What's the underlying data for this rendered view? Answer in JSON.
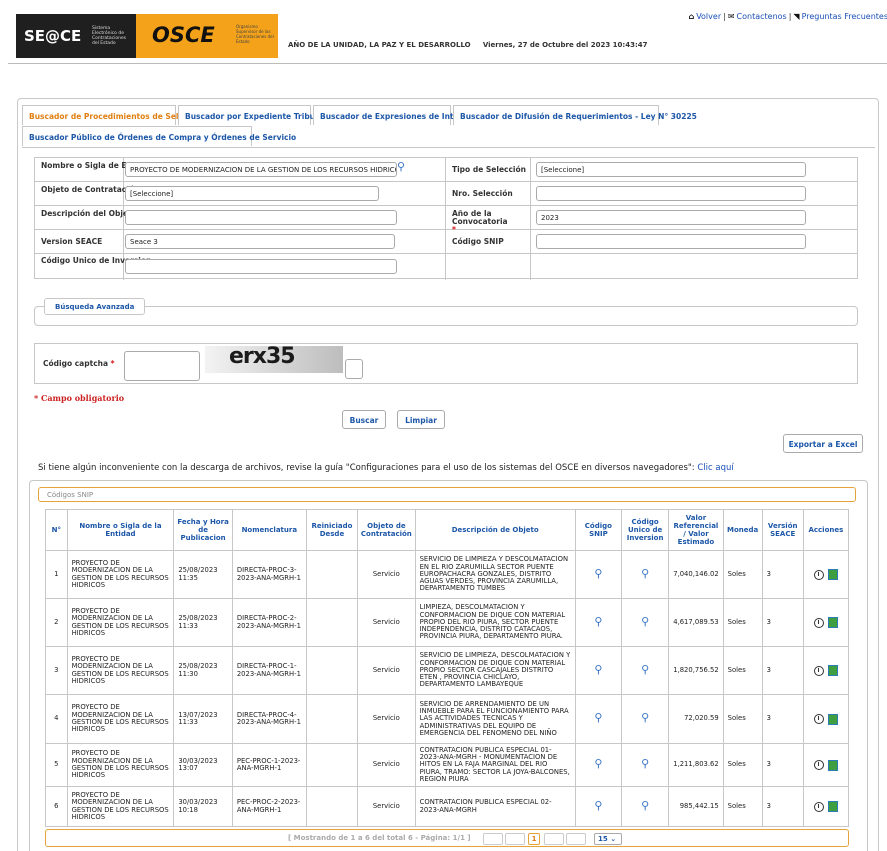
{
  "header": {
    "seace_logo": "SE@CE",
    "seace_sub": "Sistema Electrónico de Contrataciones del Estado",
    "osce_logo": "OSCE",
    "osce_sub": "Organismo Supervisor de las Contrataciones del Estado",
    "year_text": "AÑO DE LA UNIDAD, LA PAZ Y EL DESARROLLO",
    "datetime": "Viernes, 27 de Octubre del 2023 10:43:47",
    "links": {
      "back": "Volver",
      "contact": "Contactenos",
      "faq": "Preguntas Frecuentes"
    }
  },
  "tabs": [
    {
      "label": "Buscador de Procedimientos de Selección",
      "active": true
    },
    {
      "label": "Buscador por Expediente Tribunal"
    },
    {
      "label": "Buscador de Expresiones de Interés"
    },
    {
      "label": "Buscador de Difusión de Requerimientos - Ley N° 30225"
    },
    {
      "label": "Buscador Público de Órdenes de Compra y Órdenes de Servicio"
    }
  ],
  "form": {
    "entidad_label": "Nombre o Sigla de Entidad",
    "entidad_value": "PROYECTO DE MODERNIZACION DE LA GESTION DE LOS RECURSOS HIDRICOS",
    "tipo_label": "Tipo de Selección",
    "tipo_value": "[Seleccione]",
    "objeto_label": "Objeto de Contratación",
    "objeto_value": "[Seleccione]",
    "nro_label": "Nro. Selección",
    "nro_value": "",
    "desc_label": "Descripción del Objeto",
    "desc_value": "",
    "anio_label": "Año de la Convocatoria",
    "anio_value": "2023",
    "version_label": "Version SEACE",
    "version_value": "Seace 3",
    "snip_label": "Código SNIP",
    "snip_value": "",
    "inversion_label": "Código Unico de Inversion",
    "inversion_value": "",
    "required_mark": "*"
  },
  "advanced_label": "Búsqueda Avanzada",
  "captcha": {
    "label": "Código captcha",
    "image_text": "erx35",
    "value": ""
  },
  "required_note": "* Campo obligatorio",
  "buttons": {
    "search": "Buscar",
    "clear": "Limpiar",
    "export": "Exportar a Excel"
  },
  "notice": {
    "text": "Si tiene algún inconveniente con la descarga de archivos, revise la guía \"Configuraciones para el uso de los sistemas del OSCE en diversos navegadores\": ",
    "link": "Clic aquí"
  },
  "results": {
    "snip_bar": "Códigos SNIP",
    "columns": [
      "N°",
      "Nombre o Sigla de la Entidad",
      "Fecha y Hora de Publicacion",
      "Nomenclatura",
      "Reiniciado Desde",
      "Objeto de Contratación",
      "Descripción de Objeto",
      "Código SNIP",
      "Código Unico de Inversion",
      "Valor Referencial / Valor Estimado",
      "Moneda",
      "Versión SEACE",
      "Acciones"
    ],
    "rows": [
      {
        "n": "1",
        "entidad": "PROYECTO DE MODERNIZACION DE LA GESTION DE LOS RECURSOS HIDRICOS",
        "fecha": "25/08/2023 11:35",
        "nomen": "DIRECTA-PROC-3-2023-ANA-MGRH-1",
        "reini": "",
        "objeto": "Servicio",
        "desc": "SERVICIO DE LIMPIEZA Y DESCOLMATACION EN EL RIO ZARUMILLA SECTOR PUENTE EUROPACHACRA GONZALES, DISTRITO AGUAS VERDES, PROVINCIA ZARUMILLA, DEPARTAMENTO TUMBES",
        "valor": "7,040,146.02",
        "moneda": "Soles",
        "version": "3"
      },
      {
        "n": "2",
        "entidad": "PROYECTO DE MODERNIZACION DE LA GESTION DE LOS RECURSOS HIDRICOS",
        "fecha": "25/08/2023 11:33",
        "nomen": "DIRECTA-PROC-2-2023-ANA-MGRH-1",
        "reini": "",
        "objeto": "Servicio",
        "desc": "LIMPIEZA, DESCOLMATACION Y CONFORMACION DE DIQUE CON MATERIAL PROPIO DEL RIO PIURA, SECTOR PUENTE INDEPENDENCIA, DISTRITO CATACAOS, PROVINCIA PIURA, DEPARTAMENTO PIURA.",
        "valor": "4,617,089.53",
        "moneda": "Soles",
        "version": "3"
      },
      {
        "n": "3",
        "entidad": "PROYECTO DE MODERNIZACION DE LA GESTION DE LOS RECURSOS HIDRICOS",
        "fecha": "25/08/2023 11:30",
        "nomen": "DIRECTA-PROC-1-2023-ANA-MGRH-1",
        "reini": "",
        "objeto": "Servicio",
        "desc": "SERVICIO DE LIMPIEZA, DESCOLMATACION Y CONFORMACION DE DIQUE CON MATERIAL PROPIO SECTOR CASCAJALES DISTRITO ETEN , PROVINCIA CHICLAYO, DEPARTAMENTO LAMBAYEQUE",
        "valor": "1,820,756.52",
        "moneda": "Soles",
        "version": "3"
      },
      {
        "n": "4",
        "entidad": "PROYECTO DE MODERNIZACION DE LA GESTION DE LOS RECURSOS HIDRICOS",
        "fecha": "13/07/2023 11:33",
        "nomen": "DIRECTA-PROC-4-2023-ANA-MGRH-1",
        "reini": "",
        "objeto": "Servicio",
        "desc": "SERVICIO DE ARRENDAMIENTO DE UN INMUEBLE PARA EL FUNCIONAMIENTO PARA LAS ACTIVIDADES TECNICAS Y ADMINISTRATIVAS DEL EQUIPO DE EMERGENCIA DEL FENOMENO DEL NIÑO",
        "valor": "72,020.59",
        "moneda": "Soles",
        "version": "3"
      },
      {
        "n": "5",
        "entidad": "PROYECTO DE MODERNIZACION DE LA GESTION DE LOS RECURSOS HIDRICOS",
        "fecha": "30/03/2023 13:07",
        "nomen": "PEC-PROC-1-2023-ANA-MGRH-1",
        "reini": "",
        "objeto": "Servicio",
        "desc": "CONTRATACION PUBLICA ESPECIAL 01-2023-ANA-MGRH - MONUMENTACION DE HITOS EN LA FAJA MARGINAL DEL RIO PIURA, TRAMO: SECTOR LA JOYA-BALCONES, REGION PIURA",
        "valor": "1,211,803.62",
        "moneda": "Soles",
        "version": "3"
      },
      {
        "n": "6",
        "entidad": "PROYECTO DE MODERNIZACION DE LA GESTION DE LOS RECURSOS HIDRICOS",
        "fecha": "30/03/2023 10:18",
        "nomen": "PEC-PROC-2-2023-ANA-MGRH-1",
        "reini": "",
        "objeto": "Servicio",
        "desc": "CONTRATACION PUBLICA ESPECIAL 02-2023-ANA-MGRH",
        "valor": "985,442.15",
        "moneda": "Soles",
        "version": "3"
      }
    ],
    "pager_text": "[ Mostrando de 1 a 6 del total 6 - Página: 1/1 ]",
    "current_page": "1",
    "page_size": "15"
  }
}
